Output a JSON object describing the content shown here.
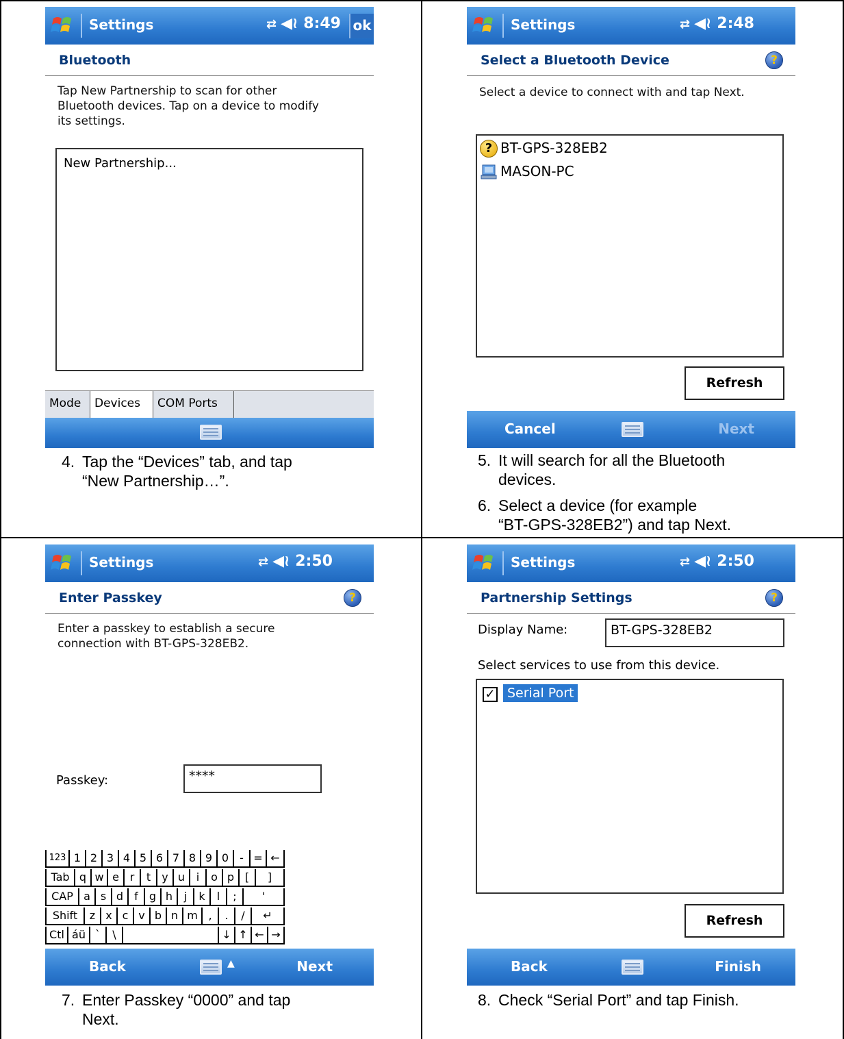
{
  "panels": {
    "p1": {
      "title": "Settings",
      "time": "8:49",
      "ok": "ok",
      "header": "Bluetooth",
      "description_lines": [
        "Tap New Partnership to scan for other",
        "Bluetooth devices. Tap on a device to modify",
        "its settings."
      ],
      "list_item": "New Partnership...",
      "tabs": [
        "Mode",
        "Devices",
        "COM Ports"
      ],
      "caption_num": "4.",
      "caption_lines": [
        "Tap the “Devices” tab, and tap",
        "“New Partnership…”."
      ]
    },
    "p2": {
      "title": "Settings",
      "time": "2:48",
      "header": "Select a Bluetooth Device",
      "description": "Select a device to connect with and tap Next.",
      "devices": [
        "BT-GPS-328EB2",
        "MASON-PC"
      ],
      "refresh": "Refresh",
      "left_soft": "Cancel",
      "right_soft": "Next",
      "caption5_num": "5.",
      "caption5_lines": [
        "It will search for all the Bluetooth",
        "devices."
      ],
      "caption6_num": "6.",
      "caption6_lines": [
        "Select a device (for example",
        "“BT-GPS-328EB2”) and tap Next."
      ]
    },
    "p3": {
      "title": "Settings",
      "time": "2:50",
      "header": "Enter Passkey",
      "description_lines": [
        "Enter a passkey to establish a secure",
        "connection with BT-GPS-328EB2."
      ],
      "passkey_label": "Passkey:",
      "passkey_value": "****",
      "left_soft": "Back",
      "right_soft": "Next",
      "keyboard": {
        "row1": [
          "123",
          "1",
          "2",
          "3",
          "4",
          "5",
          "6",
          "7",
          "8",
          "9",
          "0",
          "-",
          "=",
          "←"
        ],
        "row2": [
          "Tab",
          "q",
          "w",
          "e",
          "r",
          "t",
          "y",
          "u",
          "i",
          "o",
          "p",
          "[",
          "]"
        ],
        "row3": [
          "CAP",
          "a",
          "s",
          "d",
          "f",
          "g",
          "h",
          "j",
          "k",
          "l",
          ";",
          "'"
        ],
        "row4": [
          "Shift",
          "z",
          "x",
          "c",
          "v",
          "b",
          "n",
          "m",
          ",",
          ".",
          "/",
          "↵"
        ],
        "row5": [
          "Ctl",
          "áü",
          "`",
          "\\",
          "",
          "↓",
          "↑",
          "←",
          "→"
        ]
      },
      "caption_num": "7.",
      "caption_lines": [
        "Enter Passkey “0000” and tap",
        "Next."
      ]
    },
    "p4": {
      "title": "Settings",
      "time": "2:50",
      "header": "Partnership Settings",
      "display_name_label": "Display Name:",
      "display_name_value": "BT-GPS-328EB2",
      "services_label": "Select services to use from this device.",
      "service": "Serial Port",
      "service_checked": true,
      "refresh": "Refresh",
      "left_soft": "Back",
      "right_soft": "Finish",
      "caption_num": "8.",
      "caption_lines": [
        "Check “Serial Port” and tap Finish."
      ]
    }
  },
  "colors": {
    "titlebar": "#2e7bd0",
    "header_text": "#0a3a7a",
    "selection": "#2a78d0"
  }
}
